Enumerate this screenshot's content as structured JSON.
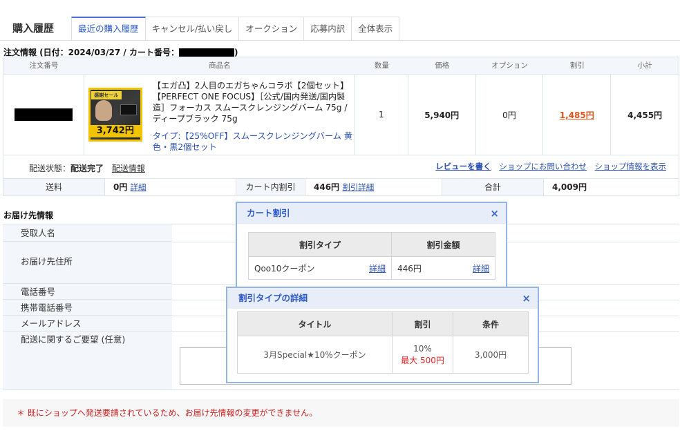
{
  "header": {
    "title": "購入履歴",
    "tabs": [
      "最近の購入履歴",
      "キャンセル/払い戻し",
      "オークション",
      "応募内訳",
      "全体表示"
    ]
  },
  "order_info": {
    "title_prefix": "注文情報 (日付：2024/03/27 / カート番号：",
    "title_suffix": ")",
    "columns": [
      "注文番号",
      "商品名",
      "数量",
      "価格",
      "オプション",
      "割引",
      "小計"
    ],
    "item": {
      "image_banner": "感謝セール",
      "image_price": "3,742円",
      "name": "【エガ凸】2人目のエガちゃんコラボ【2個セット】【PERFECT ONE FOCUS】［公式/国内発送/国内製造］フォーカス スムースクレンジングバーム 75g / ディープブラック 75g",
      "type": "タイプ:【25%OFF】スムースクレンジングバーム 黄色・黒2個セット",
      "quantity": "1",
      "price": "5,940円",
      "option": "0円",
      "discount": "1,485円",
      "subtotal": "4,455円"
    },
    "shipping_status_label": "配送状態：",
    "shipping_status_value": "配送完了",
    "shipping_info_link": "配送情報",
    "review_link": "レビューを書く",
    "contact_link": "ショップにお問い合わせ",
    "shop_info_link": "ショップ情報を表示"
  },
  "totals": {
    "shipping_label": "送料",
    "shipping_value": "0円",
    "shipping_detail": "詳細",
    "cart_discount_label": "カート内割引",
    "cart_discount_value": "446円",
    "cart_discount_detail": "割引詳細",
    "total_label": "合計",
    "total_value": "4,009円"
  },
  "delivery": {
    "title": "お届け先情報",
    "labels": [
      "受取人名",
      "お届け先住所",
      "電話番号",
      "携帯電話番号",
      "メールアドレス",
      "配送に関するご要望 (任意)"
    ]
  },
  "notice": "＊ 既にショップへ発送要請されているため、お届け先情報の変更ができません。",
  "cart_discount_popup": {
    "title": "カート割引",
    "close": "×",
    "col_type": "割引タイプ",
    "col_amount": "割引金額",
    "row_type": "Qoo10クーポン",
    "row_type_link": "詳細",
    "row_amount": "446円",
    "row_amount_link": "詳細"
  },
  "discount_detail_popup": {
    "title": "割引タイプの詳細",
    "close": "×",
    "col_title": "タイトル",
    "col_discount": "割引",
    "col_condition": "条件",
    "row_title": "3月Special★10%クーポン",
    "row_discount": "10%",
    "row_max": "最大 500円",
    "row_condition": "3,000円"
  },
  "colors": {
    "accent": "#2a58c8",
    "discount": "#e0531c",
    "warning": "#cc2222"
  }
}
